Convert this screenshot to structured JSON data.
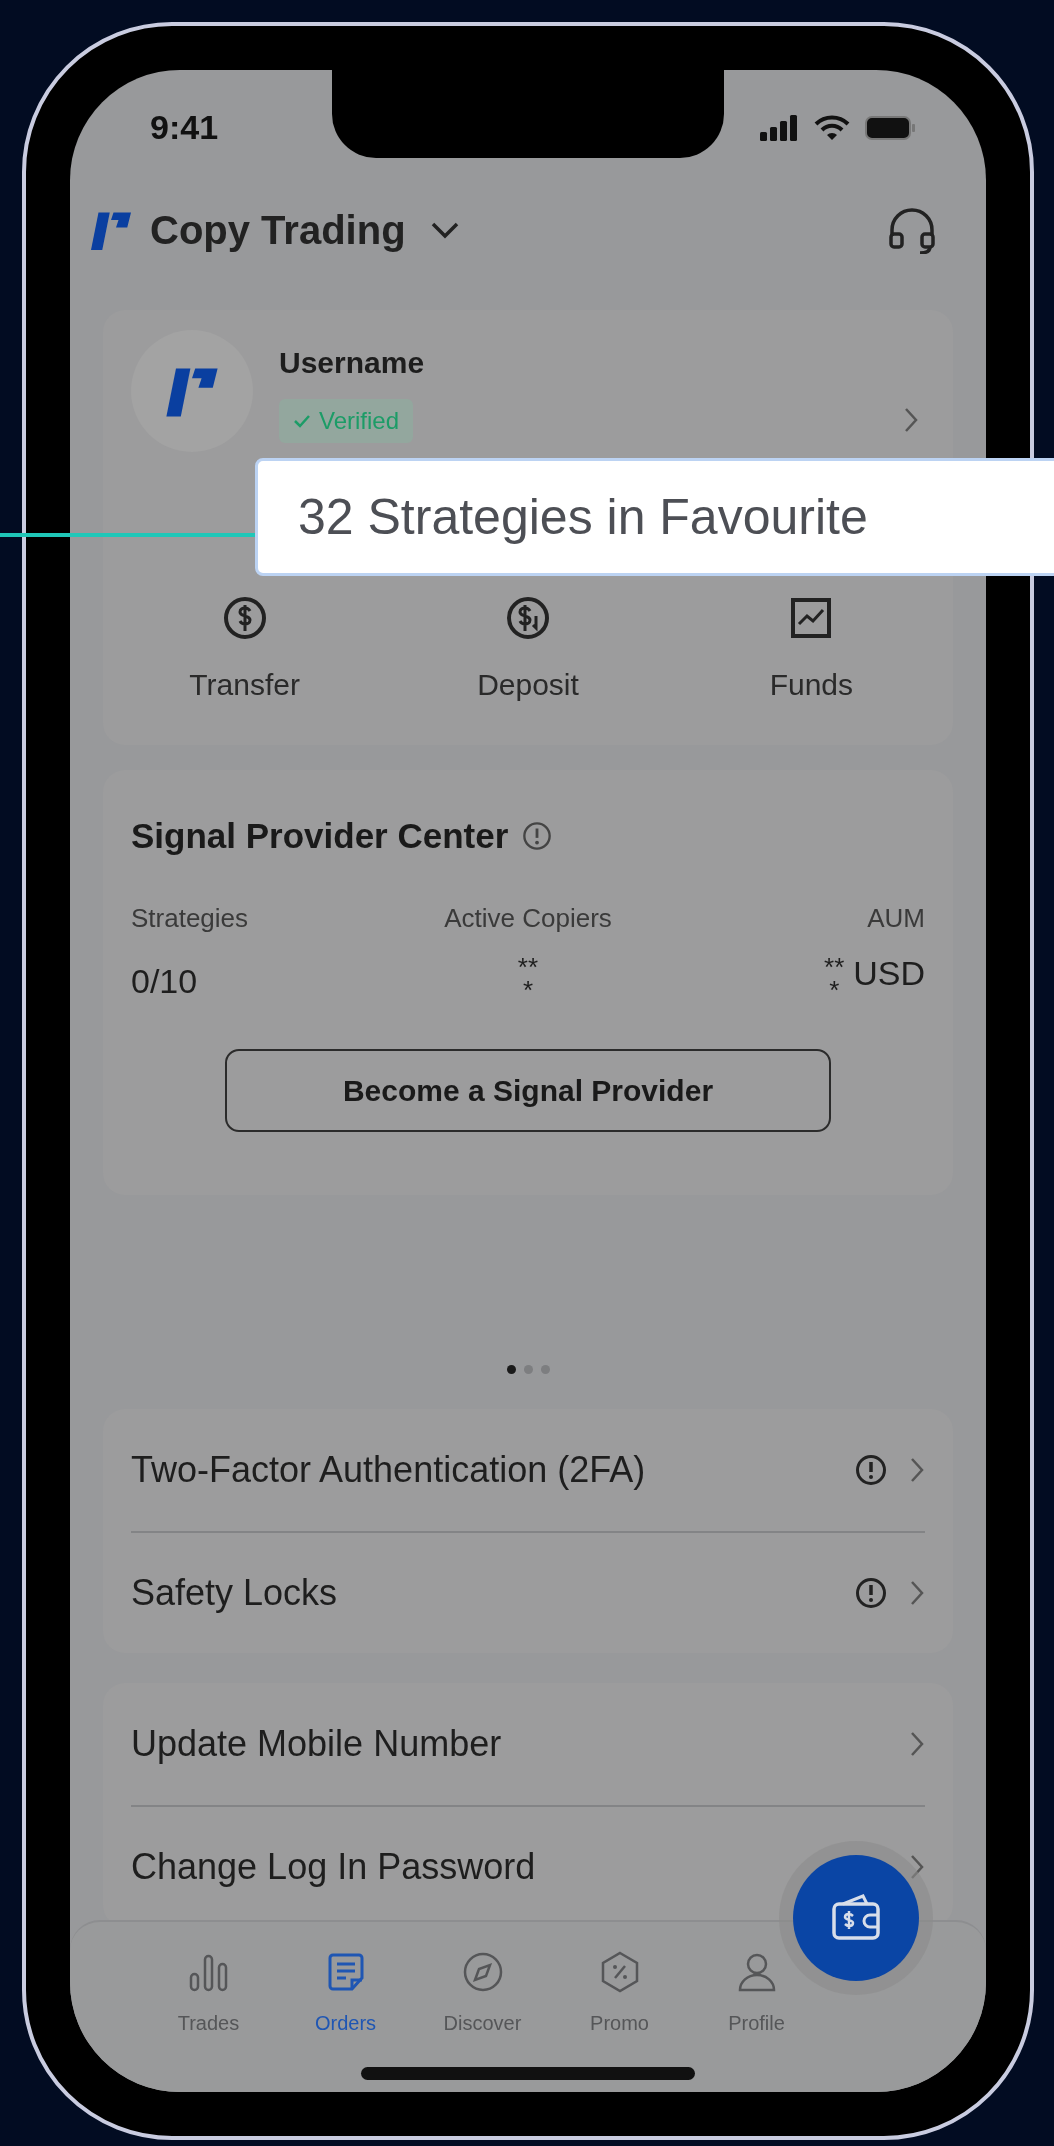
{
  "status_bar": {
    "time": "9:41"
  },
  "header": {
    "title": "Copy Trading"
  },
  "profile": {
    "username": "Username",
    "badge": "Verified"
  },
  "callout": {
    "text": "32 Strategies in Favourite"
  },
  "quick_actions": [
    {
      "label": "Transfer",
      "kind": "transfer"
    },
    {
      "label": "Deposit",
      "kind": "deposit"
    },
    {
      "label": "Funds",
      "kind": "funds"
    }
  ],
  "signal_provider": {
    "title": "Signal Provider Center",
    "stats": [
      {
        "label": "Strategies",
        "value": "0/10"
      },
      {
        "label": "Active Copiers",
        "value": "***"
      },
      {
        "label": "AUM",
        "value": "***",
        "unit": "USD"
      }
    ],
    "button": "Become a Signal Provider"
  },
  "pager": [
    {
      "selected": true
    },
    {
      "selected": false
    },
    {
      "selected": false
    }
  ],
  "security_items": [
    {
      "label": "Two-Factor Authentication (2FA)",
      "warning": true
    },
    {
      "label": "Safety Locks",
      "warning": true
    }
  ],
  "account_items": [
    {
      "label": "Update Mobile Number",
      "warning": false
    },
    {
      "label": "Change Log In Password",
      "warning": false
    }
  ],
  "bottom_nav": [
    {
      "label": "Trades",
      "kind": "trades",
      "selected": false
    },
    {
      "label": "Orders",
      "kind": "orders",
      "selected": true
    },
    {
      "label": "Discover",
      "kind": "discover",
      "selected": false
    },
    {
      "label": "Promo",
      "kind": "promo",
      "selected": false
    },
    {
      "label": "Profile",
      "kind": "profile",
      "selected": false
    }
  ]
}
